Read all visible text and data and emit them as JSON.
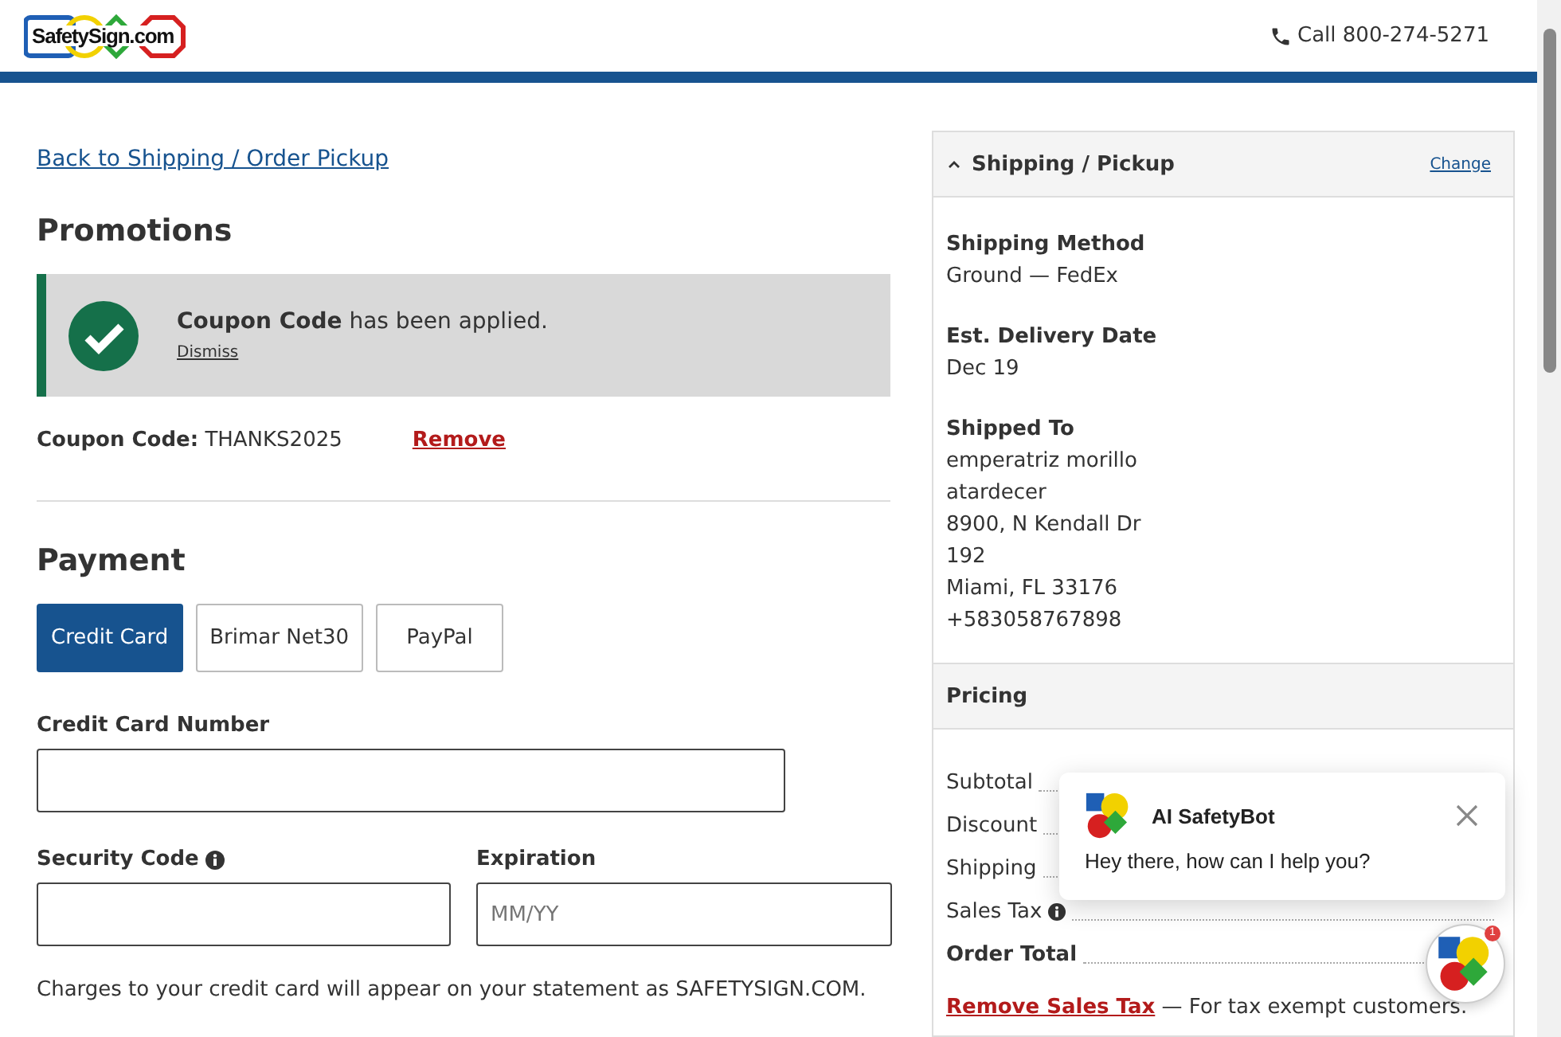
{
  "header": {
    "logo": "SafetySign.com",
    "phone": "Call 800-274-5271"
  },
  "back_link": "Back to Shipping / Order Pickup",
  "promotions": {
    "title": "Promotions",
    "alert": {
      "message": "**Coupon Code** has been applied.",
      "dismiss": "Dismiss"
    },
    "coupon_label": "Coupon Code:",
    "coupon_value": "THANKS2025",
    "remove": "Remove"
  },
  "payment": {
    "title": "Payment",
    "methods": [
      {
        "label": "Credit Card",
        "selected": true
      },
      {
        "label": "Brimar Net30",
        "selected": false
      },
      {
        "label": "PayPal",
        "selected": false
      }
    ],
    "card_number_label": "Credit Card Number",
    "security_label": "Security Code",
    "expiration_label": "Expiration",
    "expiration_placeholder": "MM/YY",
    "note": "Charges to your credit card will appear on your statement as SAFETYSIGN.COM."
  },
  "shipping": {
    "title": "Shipping / Pickup",
    "expanded": true,
    "change": "Change",
    "sections": [
      {
        "label": "Shipping Method",
        "lines": [
          "Ground — FedEx"
        ]
      },
      {
        "label": "Est. Delivery Date",
        "lines": [
          "Dec 19"
        ]
      },
      {
        "label": "Shipped To",
        "lines": [
          "emperatriz morillo",
          "atardecer",
          "8900, N Kendall Dr",
          "192",
          "Miami, FL 33176",
          "+583058767898"
        ]
      }
    ]
  },
  "pricing": {
    "title": "Pricing",
    "rows": [
      {
        "label": "Subtotal",
        "info": false,
        "bold": false
      },
      {
        "label": "Discount",
        "info": false,
        "bold": false
      },
      {
        "label": "Shipping",
        "info": false,
        "bold": false
      },
      {
        "label": "Sales Tax",
        "info": true,
        "bold": false
      },
      {
        "label": "Order Total",
        "info": false,
        "bold": true
      }
    ],
    "remove_tax": "Remove Sales Tax",
    "remove_tax_note": "— For tax exempt customers."
  },
  "chat": {
    "title": "AI SafetyBot",
    "message": "Hey there, how can I help you?",
    "badge": "1"
  }
}
